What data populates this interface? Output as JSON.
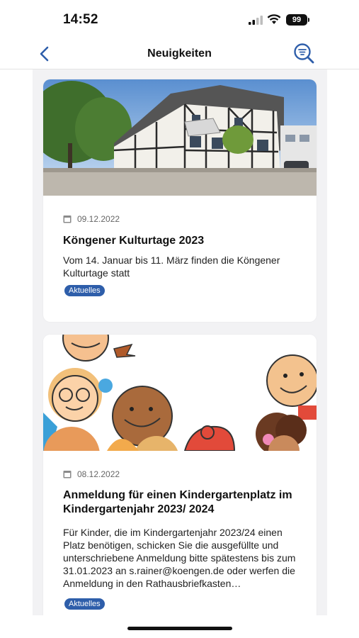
{
  "status_bar": {
    "time": "14:52",
    "battery": "99",
    "icons": [
      "signal-icon",
      "wifi-icon",
      "battery-icon"
    ]
  },
  "nav": {
    "title": "Neuigkeiten",
    "back_icon": "chevron-left-icon",
    "filter_icon": "search-filter-icon",
    "accent_color": "#2e5eaa"
  },
  "news": [
    {
      "date": "09.12.2022",
      "title": "Köngener Kulturtage 2023",
      "text": "Vom 14. Januar bis 11. März finden die Köngener Kulturtage statt",
      "tag": "Aktuelles",
      "image": "half-timbered-building-photo"
    },
    {
      "date": "08.12.2022",
      "title": "Anmeldung für einen Kindergartenplatz im Kindergartenjahr 2023/ 2024",
      "text": "Für Kinder, die im Kindergartenjahr 2023/24 einen Platz benötigen, schicken Sie die ausgefüllte und unterschriebene Anmeldung bitte spätestens bis zum 31.01.2023 an s.rainer@koengen.de oder werfen die Anmeldung in den Rathausbriefkasten…",
      "tag": "Aktuelles",
      "image": "cartoon-children-illustration"
    }
  ]
}
